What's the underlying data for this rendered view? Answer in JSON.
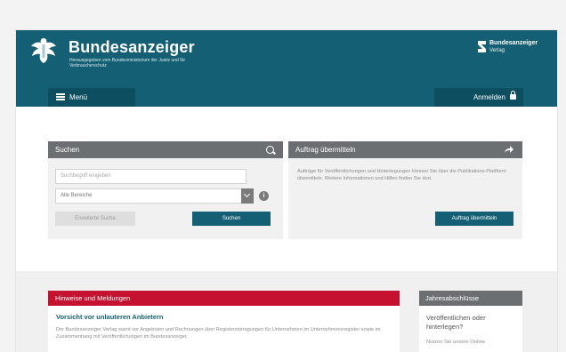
{
  "header": {
    "brand": "Bundesanzeiger",
    "subtitle": "Herausgegeben vom Bundesministerium der Justiz und für Verbraucherschutz",
    "verlag_line1": "Bundesanzeiger",
    "verlag_line2": "Verlag",
    "menu_label": "Menü",
    "login_label": "Anmelden"
  },
  "search_panel": {
    "title": "Suchen",
    "query_placeholder": "Suchbegriff eingeben",
    "area_value": "Alle Bereiche",
    "advanced_label": "Erweiterte Suche",
    "search_label": "Suchen"
  },
  "order_panel": {
    "title": "Auftrag übermitteln",
    "text": "Aufträge für Veröffentlichungen und Hinterlegungen können Sie über die Publikations-Plattform übermitteln. Weitere Informationen und Hilfen finden Sie dort.",
    "button_label": "Auftrag übermitteln"
  },
  "notices": {
    "title": "Hinweise und Meldungen",
    "headline": "Vorsicht vor unlauteren Anbietern",
    "text": "Der Bundesanzeiger Verlag warnt vor Angeboten und Rechnungen über Registereintragungen für Unternehmen im Unternehmensregister sowie im Zusammenhang mit Veröffentlichungen im Bundesanzeiger."
  },
  "annual": {
    "title": "Jahresabschlüsse",
    "headline": "Veröffentlichen oder hinterlegen?",
    "text": "Nutzen Sie unsere Online"
  },
  "colors": {
    "header": "#145f73",
    "header_dark": "#0d4e60",
    "panel_head": "#6c6f72",
    "notice_red": "#c41230"
  },
  "icons": [
    "eagle-logo",
    "verlag-logo-icon",
    "menu-icon",
    "lock-icon",
    "search-icon",
    "share-arrow-icon",
    "chevron-down-icon",
    "info-icon"
  ]
}
